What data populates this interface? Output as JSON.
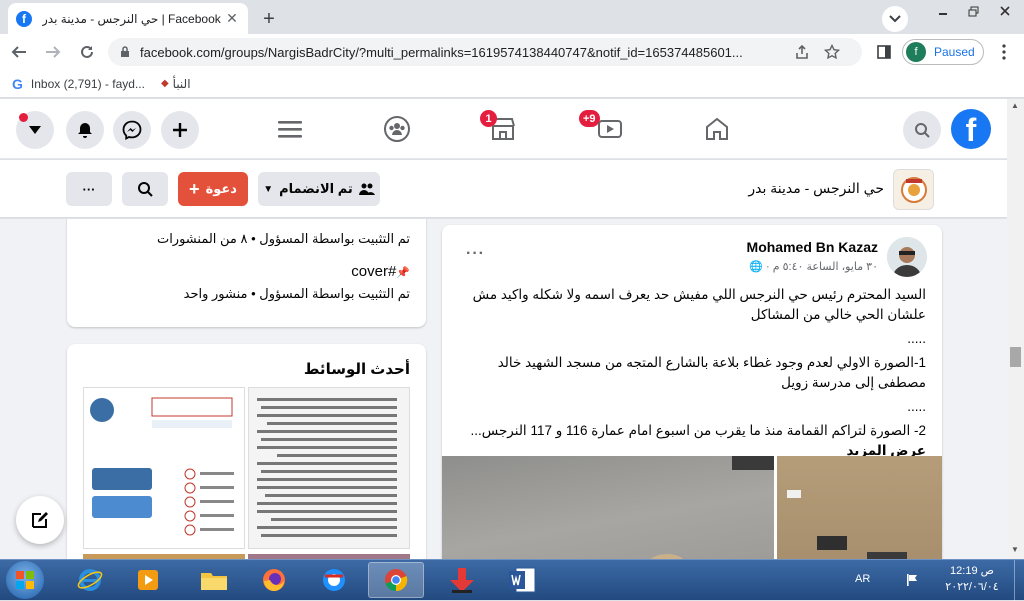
{
  "browser": {
    "tab_title": "حي النرجس - مدينة بدر | Facebook",
    "tab_close": "✕",
    "new_tab": "+",
    "url": "facebook.com/groups/NargisBadrCity/?multi_permalinks=1619574138440747&notif_id=165374485601...",
    "profile_initial": "f",
    "profile_label": "Paused",
    "bookmarks": [
      {
        "label": "Inbox (2,791) - fayd..."
      },
      {
        "label": "النبأ"
      }
    ]
  },
  "fb_header": {
    "badge_marketplace": "1",
    "badge_watch": "+9",
    "logo_letter": "f"
  },
  "group": {
    "name": "حي النرجس - مدينة بدر",
    "join_label": "تم الانضمام",
    "invite_label": "دعوة",
    "more": "···"
  },
  "pinned": {
    "item1_meta": "تم التثبيت بواسطة المسؤول • ٨ من المنشورات",
    "item2_tag": "#cover",
    "item2_meta": "تم التثبيت بواسطة المسؤول • منشور واحد"
  },
  "media": {
    "heading": "أحدث الوسائط"
  },
  "post": {
    "author": "Mohamed Bn Kazaz",
    "time": "٣٠ مايو، الساعة ٥:٤٠ م ·",
    "more": "···",
    "para1": "السيد المحترم رئيس حي النرجس اللي مفيش حد يعرف اسمه ولا شكله واكيد مش علشان الحي خالي من المشاكل",
    "dots1": ".....",
    "para2": "1-الصورة الاولي لعدم وجود غطاء بلاعة بالشارع المتجه من مسجد الشهيد خالد مصطفى إلى مدرسة زويل",
    "dots2": ".....",
    "para3": "2- الصورة لتراكم القمامة منذ ما يقرب من اسبوع امام عمارة 116 و 117 النرجس...",
    "see_more": "عرض المزيد"
  },
  "taskbar": {
    "lang": "AR",
    "time": "12:19 ص",
    "date": "٢٠٢٢/٠٦/٠٤"
  },
  "colors": {
    "fb_blue": "#1877f2",
    "invite_red": "#e4513b",
    "badge_red": "#e41e3f"
  }
}
